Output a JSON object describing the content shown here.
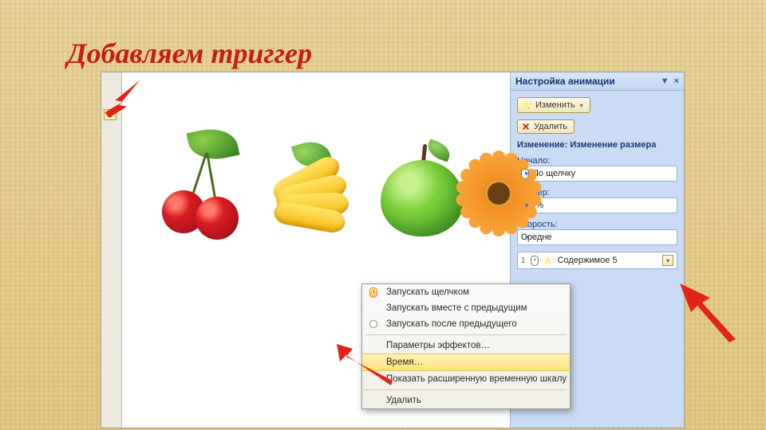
{
  "title": "Добавляем триггер",
  "gutter": {
    "flag": "1"
  },
  "pane": {
    "title": "Настройка анимации",
    "buttons": {
      "change": "Изменить",
      "remove": "Удалить"
    },
    "change_line": "Изменение: Изменение размера",
    "start": {
      "label": "Начало:",
      "value": "По щелчку"
    },
    "size": {
      "label": "Размер:",
      "value": "150%"
    },
    "speed": {
      "label": "Скорость:",
      "value": "Средне"
    },
    "item": {
      "index": "1",
      "name": "Содержимое 5"
    }
  },
  "ctx": {
    "m1": "Запускать щелчком",
    "m2": "Запускать вместе с предыдущим",
    "m3": "Запускать после предыдущего",
    "m4": "Параметры эффектов…",
    "m5": "Время…",
    "m6": "Показать расширенную временную шкалу",
    "m7": "Удалить"
  },
  "colors": {
    "title": "#c51d11",
    "pane_bg": "#c9dcf3"
  }
}
